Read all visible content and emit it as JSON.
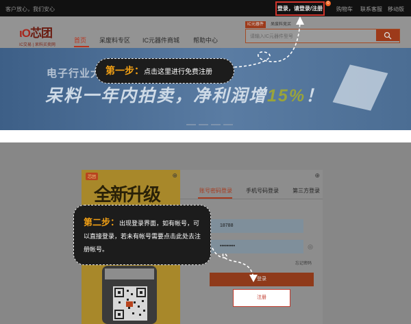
{
  "topbar": {
    "slogan": "客户放心，我们安心",
    "login_register": "登录，请登录/注册",
    "cart_badge": "0",
    "cart": "购物车",
    "contact": "联系客服",
    "mobile": "移动版"
  },
  "logo": {
    "brand": "芯团",
    "tagline": "IC交易 | 呆料买卖网"
  },
  "nav": {
    "items": [
      "首页",
      "呆废料专区",
      "IC元器件商城",
      "帮助中心"
    ]
  },
  "search": {
    "tags": [
      "IC元器件",
      "呆废料竞买"
    ],
    "placeholder": "请输入IC元器件型号"
  },
  "banner": {
    "line1": "电子行业大",
    "line2": "呆料一年内拍卖，净利润增",
    "percent": "15%",
    "end": "！"
  },
  "poster": {
    "tag": "芯团",
    "headline": "全新升级"
  },
  "login": {
    "tabs": [
      "账号密码登录",
      "手机号码登录",
      "第三方登录"
    ],
    "username": "18788",
    "password": "•••••••••",
    "forgot": "忘记密码",
    "submit": "登录",
    "register": "注册"
  },
  "callouts": {
    "step1_label": "第一步：",
    "step1_text": "点击这里进行免费注册",
    "step2_label": "第二步：",
    "step2_text": "出现登录界面，如有帐号，可以直接登录，若未有帐号需要点击此处去注册帐号。"
  },
  "colors": {
    "highlight": "#f2a014",
    "accent_red": "#c0392b",
    "topbar": "#111111"
  }
}
